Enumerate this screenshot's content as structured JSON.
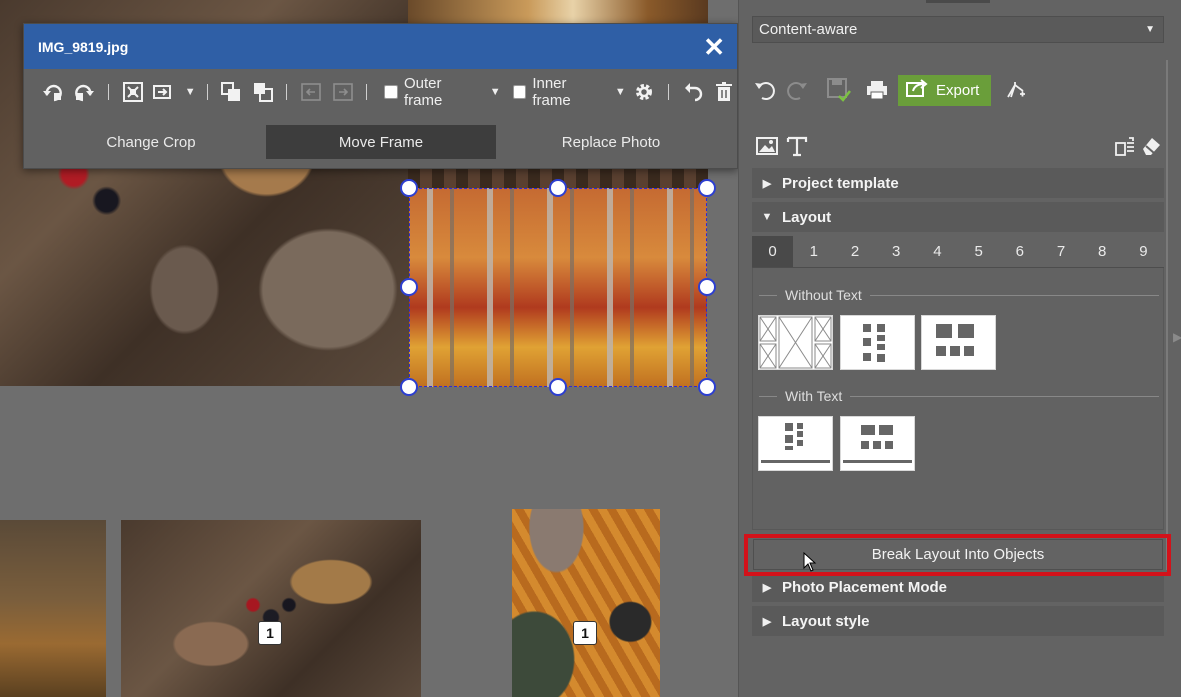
{
  "dialog": {
    "title": "IMG_9819.jpg",
    "close_glyph": "✕",
    "toolbar": {
      "outer_frame_label": "Outer frame",
      "inner_frame_label": "Inner frame",
      "caret": "▼"
    },
    "tabs": [
      {
        "label": "Change Crop",
        "active": false
      },
      {
        "label": "Move Frame",
        "active": true
      },
      {
        "label": "Replace Photo",
        "active": false
      }
    ]
  },
  "canvas": {
    "photo_count_badges": [
      "1",
      "1"
    ]
  },
  "panel": {
    "crop_mode": {
      "selected": "Content-aware",
      "caret": "▼"
    },
    "export_label": "Export",
    "sections": {
      "project_template": "Project template",
      "layout": "Layout",
      "photo_placement": "Photo Placement Mode",
      "layout_style": "Layout style"
    },
    "arrows": {
      "collapsed": "▶",
      "expanded": "▼"
    },
    "layout_tabs": [
      "0",
      "1",
      "2",
      "3",
      "4",
      "5",
      "6",
      "7",
      "8",
      "9"
    ],
    "active_layout_tab": "0",
    "groups": {
      "without_text": "Without Text",
      "with_text": "With Text"
    },
    "break_layout_label": "Break Layout Into Objects"
  },
  "icons": {
    "dialog_toolbar": [
      "rotate-left-icon",
      "rotate-right-icon",
      "fit-frame-icon",
      "align-icon",
      "bring-front-icon",
      "send-back-icon",
      "move-left-icon",
      "move-right-icon",
      "settings-icon",
      "undo-icon",
      "trash-icon"
    ],
    "panel_actions": [
      "undo-icon",
      "redo-icon",
      "save-icon",
      "print-icon",
      "export-icon",
      "share-icon"
    ],
    "panel_tools": [
      "image-tool-icon",
      "text-tool-icon",
      "layers-icon",
      "eraser-icon"
    ]
  },
  "colors": {
    "dialog_titlebar": "#2f5fa6",
    "export_button": "#6a9e3a",
    "highlight_outline": "#d3121a",
    "selection_handles": "#2d3fd0"
  }
}
